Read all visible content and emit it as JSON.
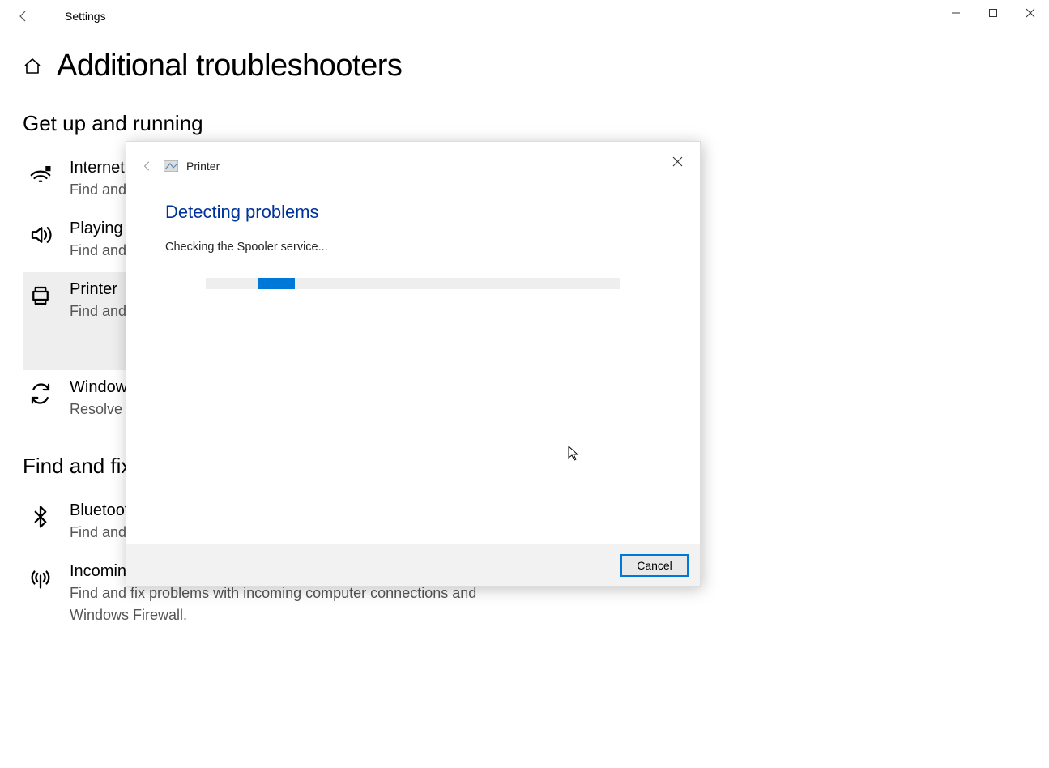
{
  "window": {
    "app_title": "Settings"
  },
  "page": {
    "title": "Additional troubleshooters",
    "section1_title": "Get up and running",
    "section2_title": "Find and fix other problems"
  },
  "items1": [
    {
      "title": "Internet",
      "desc": "Find and fix problems with connecting to the Internet or to websites."
    },
    {
      "title": "Playing Audio",
      "desc": "Find and fix problems with playing sound."
    },
    {
      "title": "Printer",
      "desc": "Find and fix problems with printing."
    },
    {
      "title": "Windows Update",
      "desc": "Resolve problems that prevent you from updating Windows."
    }
  ],
  "items2": [
    {
      "title": "Bluetooth",
      "desc": "Find and fix problems with Bluetooth devices"
    },
    {
      "title": "Incoming Connections",
      "desc": "Find and fix problems with incoming computer connections and Windows Firewall."
    }
  ],
  "dialog": {
    "title": "Printer",
    "heading": "Detecting problems",
    "status": "Checking the Spooler service...",
    "cancel_label": "Cancel"
  }
}
